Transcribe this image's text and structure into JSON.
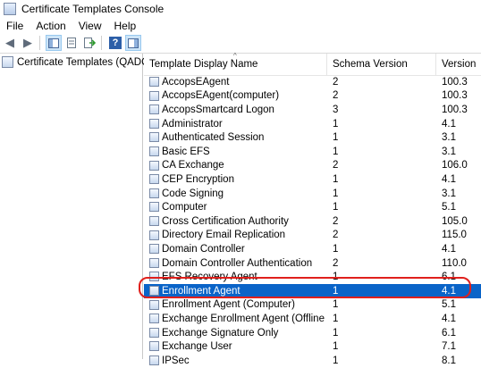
{
  "window": {
    "title": "Certificate Templates Console"
  },
  "menu": [
    "File",
    "Action",
    "View",
    "Help"
  ],
  "toolbar": {
    "icons": [
      "back-arrow-icon",
      "forward-arrow-icon",
      "show-hide-tree-icon",
      "properties-icon",
      "export-list-icon",
      "help-icon",
      "show-action-pane-icon"
    ]
  },
  "tree": {
    "root_label": "Certificate Templates (QADC.pt"
  },
  "table": {
    "columns": [
      "Template Display Name",
      "Schema Version",
      "Version"
    ],
    "rows": [
      {
        "name": "AccopsEAgent",
        "schema": "2",
        "version": "100.3"
      },
      {
        "name": "AccopsEAgent(computer)",
        "schema": "2",
        "version": "100.3"
      },
      {
        "name": "AccopsSmartcard Logon",
        "schema": "3",
        "version": "100.3"
      },
      {
        "name": "Administrator",
        "schema": "1",
        "version": "4.1"
      },
      {
        "name": "Authenticated Session",
        "schema": "1",
        "version": "3.1"
      },
      {
        "name": "Basic EFS",
        "schema": "1",
        "version": "3.1"
      },
      {
        "name": "CA Exchange",
        "schema": "2",
        "version": "106.0"
      },
      {
        "name": "CEP Encryption",
        "schema": "1",
        "version": "4.1"
      },
      {
        "name": "Code Signing",
        "schema": "1",
        "version": "3.1"
      },
      {
        "name": "Computer",
        "schema": "1",
        "version": "5.1"
      },
      {
        "name": "Cross Certification Authority",
        "schema": "2",
        "version": "105.0"
      },
      {
        "name": "Directory Email Replication",
        "schema": "2",
        "version": "115.0"
      },
      {
        "name": "Domain Controller",
        "schema": "1",
        "version": "4.1"
      },
      {
        "name": "Domain Controller Authentication",
        "schema": "2",
        "version": "110.0"
      },
      {
        "name": "EFS Recovery Agent",
        "schema": "1",
        "version": "6.1"
      },
      {
        "name": "Enrollment Agent",
        "schema": "1",
        "version": "4.1",
        "selected": true
      },
      {
        "name": "Enrollment Agent (Computer)",
        "schema": "1",
        "version": "5.1"
      },
      {
        "name": "Exchange Enrollment Agent (Offline requ...",
        "schema": "1",
        "version": "4.1"
      },
      {
        "name": "Exchange Signature Only",
        "schema": "1",
        "version": "6.1"
      },
      {
        "name": "Exchange User",
        "schema": "1",
        "version": "7.1"
      },
      {
        "name": "IPSec",
        "schema": "1",
        "version": "8.1"
      }
    ]
  },
  "colors": {
    "selection": "#0a64c8",
    "highlight_ring": "#e0201c"
  }
}
